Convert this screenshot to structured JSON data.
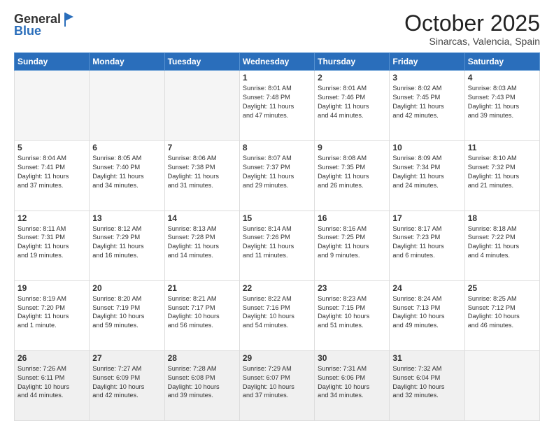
{
  "header": {
    "logo_line1": "General",
    "logo_line2": "Blue",
    "month": "October 2025",
    "location": "Sinarcas, Valencia, Spain"
  },
  "days_of_week": [
    "Sunday",
    "Monday",
    "Tuesday",
    "Wednesday",
    "Thursday",
    "Friday",
    "Saturday"
  ],
  "weeks": [
    [
      {
        "day": "",
        "info": ""
      },
      {
        "day": "",
        "info": ""
      },
      {
        "day": "",
        "info": ""
      },
      {
        "day": "1",
        "info": "Sunrise: 8:01 AM\nSunset: 7:48 PM\nDaylight: 11 hours\nand 47 minutes."
      },
      {
        "day": "2",
        "info": "Sunrise: 8:01 AM\nSunset: 7:46 PM\nDaylight: 11 hours\nand 44 minutes."
      },
      {
        "day": "3",
        "info": "Sunrise: 8:02 AM\nSunset: 7:45 PM\nDaylight: 11 hours\nand 42 minutes."
      },
      {
        "day": "4",
        "info": "Sunrise: 8:03 AM\nSunset: 7:43 PM\nDaylight: 11 hours\nand 39 minutes."
      }
    ],
    [
      {
        "day": "5",
        "info": "Sunrise: 8:04 AM\nSunset: 7:41 PM\nDaylight: 11 hours\nand 37 minutes."
      },
      {
        "day": "6",
        "info": "Sunrise: 8:05 AM\nSunset: 7:40 PM\nDaylight: 11 hours\nand 34 minutes."
      },
      {
        "day": "7",
        "info": "Sunrise: 8:06 AM\nSunset: 7:38 PM\nDaylight: 11 hours\nand 31 minutes."
      },
      {
        "day": "8",
        "info": "Sunrise: 8:07 AM\nSunset: 7:37 PM\nDaylight: 11 hours\nand 29 minutes."
      },
      {
        "day": "9",
        "info": "Sunrise: 8:08 AM\nSunset: 7:35 PM\nDaylight: 11 hours\nand 26 minutes."
      },
      {
        "day": "10",
        "info": "Sunrise: 8:09 AM\nSunset: 7:34 PM\nDaylight: 11 hours\nand 24 minutes."
      },
      {
        "day": "11",
        "info": "Sunrise: 8:10 AM\nSunset: 7:32 PM\nDaylight: 11 hours\nand 21 minutes."
      }
    ],
    [
      {
        "day": "12",
        "info": "Sunrise: 8:11 AM\nSunset: 7:31 PM\nDaylight: 11 hours\nand 19 minutes."
      },
      {
        "day": "13",
        "info": "Sunrise: 8:12 AM\nSunset: 7:29 PM\nDaylight: 11 hours\nand 16 minutes."
      },
      {
        "day": "14",
        "info": "Sunrise: 8:13 AM\nSunset: 7:28 PM\nDaylight: 11 hours\nand 14 minutes."
      },
      {
        "day": "15",
        "info": "Sunrise: 8:14 AM\nSunset: 7:26 PM\nDaylight: 11 hours\nand 11 minutes."
      },
      {
        "day": "16",
        "info": "Sunrise: 8:16 AM\nSunset: 7:25 PM\nDaylight: 11 hours\nand 9 minutes."
      },
      {
        "day": "17",
        "info": "Sunrise: 8:17 AM\nSunset: 7:23 PM\nDaylight: 11 hours\nand 6 minutes."
      },
      {
        "day": "18",
        "info": "Sunrise: 8:18 AM\nSunset: 7:22 PM\nDaylight: 11 hours\nand 4 minutes."
      }
    ],
    [
      {
        "day": "19",
        "info": "Sunrise: 8:19 AM\nSunset: 7:20 PM\nDaylight: 11 hours\nand 1 minute."
      },
      {
        "day": "20",
        "info": "Sunrise: 8:20 AM\nSunset: 7:19 PM\nDaylight: 10 hours\nand 59 minutes."
      },
      {
        "day": "21",
        "info": "Sunrise: 8:21 AM\nSunset: 7:17 PM\nDaylight: 10 hours\nand 56 minutes."
      },
      {
        "day": "22",
        "info": "Sunrise: 8:22 AM\nSunset: 7:16 PM\nDaylight: 10 hours\nand 54 minutes."
      },
      {
        "day": "23",
        "info": "Sunrise: 8:23 AM\nSunset: 7:15 PM\nDaylight: 10 hours\nand 51 minutes."
      },
      {
        "day": "24",
        "info": "Sunrise: 8:24 AM\nSunset: 7:13 PM\nDaylight: 10 hours\nand 49 minutes."
      },
      {
        "day": "25",
        "info": "Sunrise: 8:25 AM\nSunset: 7:12 PM\nDaylight: 10 hours\nand 46 minutes."
      }
    ],
    [
      {
        "day": "26",
        "info": "Sunrise: 7:26 AM\nSunset: 6:11 PM\nDaylight: 10 hours\nand 44 minutes."
      },
      {
        "day": "27",
        "info": "Sunrise: 7:27 AM\nSunset: 6:09 PM\nDaylight: 10 hours\nand 42 minutes."
      },
      {
        "day": "28",
        "info": "Sunrise: 7:28 AM\nSunset: 6:08 PM\nDaylight: 10 hours\nand 39 minutes."
      },
      {
        "day": "29",
        "info": "Sunrise: 7:29 AM\nSunset: 6:07 PM\nDaylight: 10 hours\nand 37 minutes."
      },
      {
        "day": "30",
        "info": "Sunrise: 7:31 AM\nSunset: 6:06 PM\nDaylight: 10 hours\nand 34 minutes."
      },
      {
        "day": "31",
        "info": "Sunrise: 7:32 AM\nSunset: 6:04 PM\nDaylight: 10 hours\nand 32 minutes."
      },
      {
        "day": "",
        "info": ""
      }
    ]
  ]
}
